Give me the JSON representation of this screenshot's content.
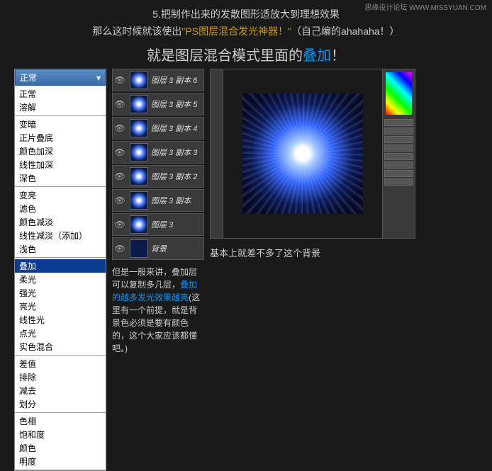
{
  "watermark": "思缘设计论坛 WWW.MISSYUAN.COM",
  "header": {
    "step": "5.把制作出来的发散图形适放大到理想效果",
    "line2_pre": "那么这时候就该使出",
    "line2_quote": "\"PS图层混合发光神器！\"",
    "line2_post": "（自己编的ahahaha！）",
    "title_pre": "就是图层混合模式里面的",
    "title_hl": "叠加",
    "title_post": "！"
  },
  "blend": {
    "current": "正常",
    "groups": [
      [
        "正常",
        "溶解"
      ],
      [
        "变暗",
        "正片叠底",
        "颜色加深",
        "线性加深",
        "深色"
      ],
      [
        "变亮",
        "滤色",
        "颜色减淡",
        "线性减淡（添加）",
        "浅色"
      ],
      [
        "叠加",
        "柔光",
        "强光",
        "亮光",
        "线性光",
        "点光",
        "实色混合"
      ],
      [
        "差值",
        "排除",
        "减去",
        "划分"
      ],
      [
        "色相",
        "饱和度",
        "颜色",
        "明度"
      ]
    ],
    "selected": "叠加"
  },
  "layers": [
    {
      "name": "图层 3 副本 6",
      "bg": false
    },
    {
      "name": "图层 3 副本 5",
      "bg": false
    },
    {
      "name": "图层 3 副本 4",
      "bg": false
    },
    {
      "name": "图层 3 副本 3",
      "bg": false
    },
    {
      "name": "图层 3 副本 2",
      "bg": false
    },
    {
      "name": "图层 3 副本",
      "bg": false
    },
    {
      "name": "图层 3",
      "bg": false
    },
    {
      "name": "背景",
      "bg": true
    }
  ],
  "note": {
    "p1": "但是一般来讲，叠加层可以复制多几层，",
    "p2": "叠加的越多发光效果越亮",
    "p3": "(这里有一个前提，就是背景色必须是要有颜色的，这个大家应该都懂吧。)"
  },
  "caption": "基本上就差不多了这个背景"
}
